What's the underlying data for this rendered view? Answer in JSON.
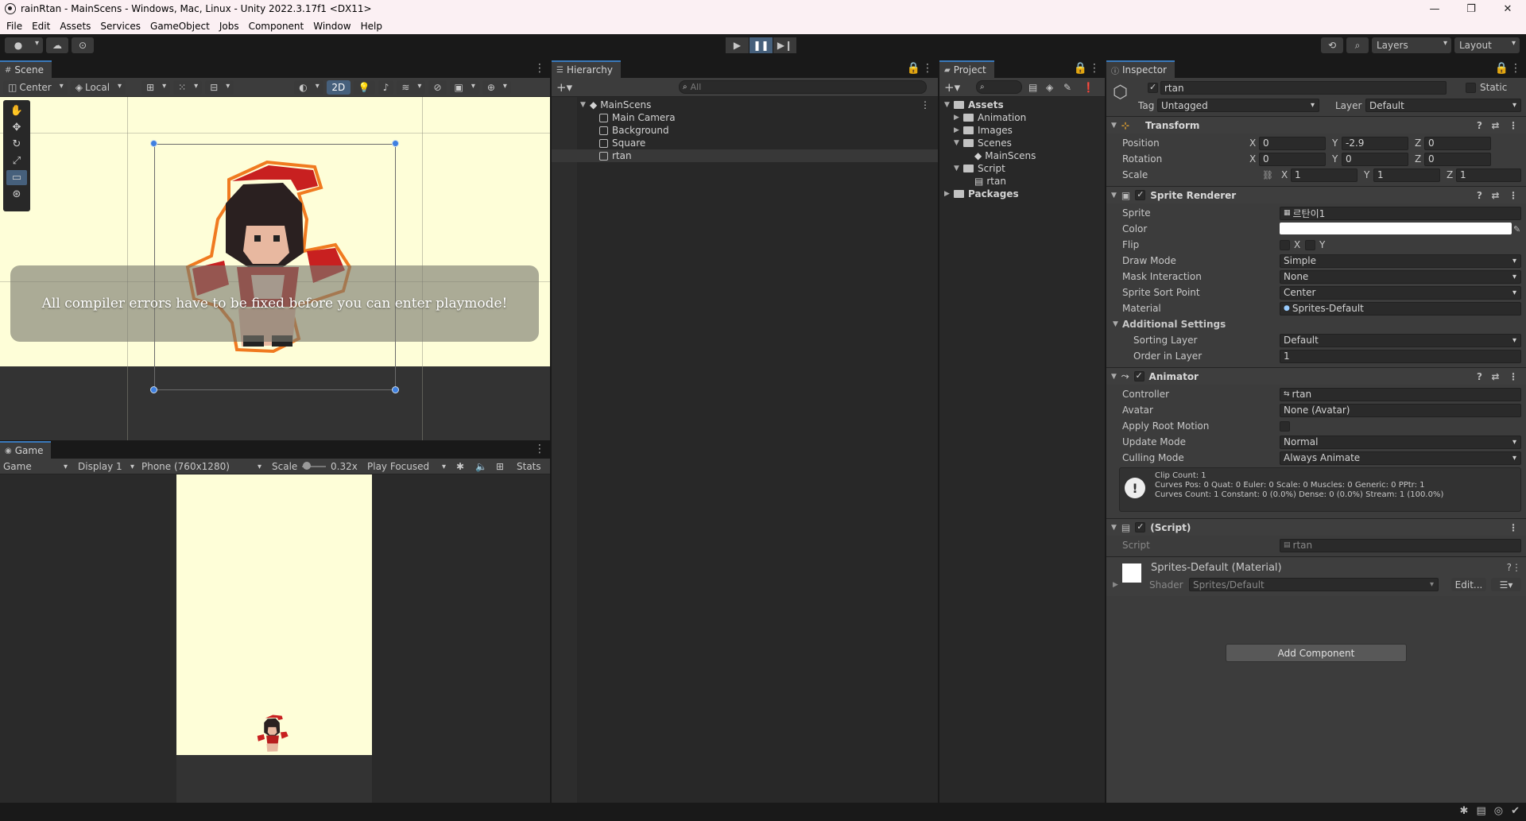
{
  "window": {
    "title": "rainRtan - MainScens - Windows, Mac, Linux - Unity 2022.3.17f1 <DX11>",
    "controls": [
      "—",
      "❐",
      "✕"
    ]
  },
  "menu": [
    "File",
    "Edit",
    "Assets",
    "Services",
    "GameObject",
    "Jobs",
    "Component",
    "Window",
    "Help"
  ],
  "toolbar": {
    "account_label": "",
    "layers_label": "Layers",
    "layout_label": "Layout"
  },
  "scene": {
    "tab_label": "Scene",
    "pivot_label": "Center",
    "space_label": "Local",
    "mode_2d": "2D",
    "error_message": "All compiler errors have to be fixed before you can enter playmode!"
  },
  "game": {
    "tab_label": "Game",
    "view_select": "Game",
    "display_select": "Display 1",
    "resolution_select": "Phone (760x1280)",
    "scale_label": "Scale",
    "scale_value": "0.32x",
    "play_mode_select": "Play Focused",
    "stats_label": "Stats"
  },
  "hierarchy": {
    "tab_label": "Hierarchy",
    "search_placeholder": "All",
    "scene_name": "MainScens",
    "items": [
      "Main Camera",
      "Background",
      "Square",
      "rtan"
    ]
  },
  "project": {
    "tab_label": "Project",
    "assets_label": "Assets",
    "folders": [
      "Animation",
      "Images",
      "Scenes",
      "MainScens",
      "Script",
      "rtan",
      "Packages"
    ]
  },
  "inspector": {
    "tab_label": "Inspector",
    "object_name": "rtan",
    "static_label": "Static",
    "tag_label": "Tag",
    "tag_value": "Untagged",
    "layer_label": "Layer",
    "layer_value": "Default",
    "transform": {
      "title": "Transform",
      "position_label": "Position",
      "rotation_label": "Rotation",
      "scale_label": "Scale",
      "position": [
        "0",
        "-2.9",
        "0"
      ],
      "rotation": [
        "0",
        "0",
        "0"
      ],
      "scale": [
        "1",
        "1",
        "1"
      ]
    },
    "sprite_renderer": {
      "title": "Sprite Renderer",
      "sprite_label": "Sprite",
      "sprite_value": "르탄이1",
      "color_label": "Color",
      "flip_label": "Flip",
      "draw_mode_label": "Draw Mode",
      "draw_mode_value": "Simple",
      "mask_label": "Mask Interaction",
      "mask_value": "None",
      "sort_point_label": "Sprite Sort Point",
      "sort_point_value": "Center",
      "material_label": "Material",
      "material_value": "Sprites-Default",
      "additional_label": "Additional Settings",
      "sorting_layer_label": "Sorting Layer",
      "sorting_layer_value": "Default",
      "order_label": "Order in Layer",
      "order_value": "1"
    },
    "animator": {
      "title": "Animator",
      "controller_label": "Controller",
      "controller_value": "rtan",
      "avatar_label": "Avatar",
      "avatar_value": "None (Avatar)",
      "root_motion_label": "Apply Root Motion",
      "update_mode_label": "Update Mode",
      "update_mode_value": "Normal",
      "culling_label": "Culling Mode",
      "culling_value": "Always Animate",
      "info_line1": "Clip Count: 1",
      "info_line2": "Curves Pos: 0 Quat: 0 Euler: 0 Scale: 0 Muscles: 0 Generic: 0 PPtr: 1",
      "info_line3": "Curves Count: 1 Constant: 0 (0.0%) Dense: 0 (0.0%) Stream: 1 (100.0%)"
    },
    "script": {
      "title": "(Script)",
      "script_label": "Script",
      "script_value": "rtan"
    },
    "material": {
      "title": "Sprites-Default (Material)",
      "shader_label": "Shader",
      "shader_value": "Sprites/Default",
      "edit_label": "Edit..."
    },
    "add_component": "Add Component"
  },
  "colors": {
    "accent": "#3a79bb",
    "scene_bg": "#fefed8",
    "panel": "#282828",
    "inspector": "#3c3c3c"
  }
}
